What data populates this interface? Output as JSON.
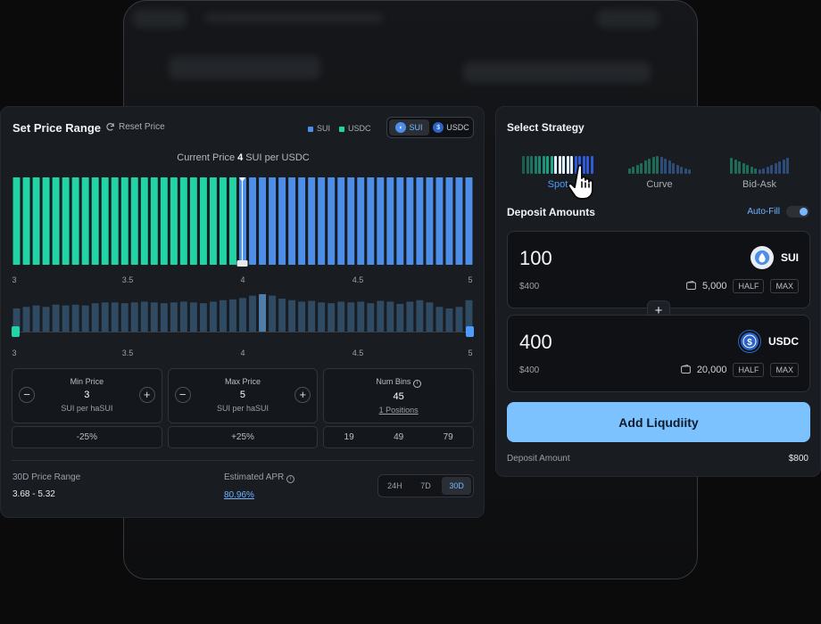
{
  "range_panel": {
    "title": "Set Price Range",
    "reset_label": "Reset Price",
    "legend": [
      {
        "label": "SUI",
        "color": "#4d8fe8"
      },
      {
        "label": "USDC",
        "color": "#22d3a6"
      }
    ],
    "token_toggle": [
      {
        "label": "SUI",
        "icon": "sui-icon",
        "active": true
      },
      {
        "label": "USDC",
        "icon": "usdc-icon",
        "active": false
      }
    ],
    "current_price": {
      "prefix": "Current Price",
      "value": "4",
      "suffix": "SUI per USDC"
    },
    "axis_ticks": [
      "3",
      "3.5",
      "4",
      "4.5",
      "5"
    ],
    "min_price": {
      "label": "Min Price",
      "value": "3",
      "unit": "SUI per haSUI",
      "pct": "-25%"
    },
    "max_price": {
      "label": "Max Price",
      "value": "5",
      "unit": "SUI per haSUI",
      "pct": "+25%"
    },
    "num_bins": {
      "label": "Num Bins",
      "value": "45",
      "sub": "1 Positions",
      "options": [
        "19",
        "49",
        "79"
      ]
    },
    "price_range_30d": {
      "label": "30D Price Range",
      "value": "3.68 - 5.32"
    },
    "apr": {
      "label": "Estimated APR",
      "value": "80.96%"
    },
    "periods": [
      {
        "label": "24H",
        "active": false
      },
      {
        "label": "7D",
        "active": false
      },
      {
        "label": "30D",
        "active": true
      }
    ]
  },
  "chart_data": [
    {
      "type": "bar",
      "x_range": [
        3,
        5
      ],
      "ticks": [
        3,
        3.5,
        4,
        4.5,
        5
      ],
      "series": [
        {
          "name": "USDC",
          "color": "#22d3a6",
          "values": [
            1,
            1,
            1,
            1,
            1,
            1,
            1,
            1,
            1,
            1,
            1,
            1,
            1,
            1,
            1,
            1,
            1,
            1,
            1,
            1,
            1,
            1,
            1,
            0,
            0,
            0,
            0,
            0,
            0,
            0,
            0,
            0,
            0,
            0,
            0,
            0,
            0,
            0,
            0,
            0,
            0,
            0,
            0,
            0,
            0,
            0,
            0
          ]
        },
        {
          "name": "SUI",
          "color": "#4d8fe8",
          "values": [
            0,
            0,
            0,
            0,
            0,
            0,
            0,
            0,
            0,
            0,
            0,
            0,
            0,
            0,
            0,
            0,
            0,
            0,
            0,
            0,
            0,
            0,
            0,
            1,
            1,
            1,
            1,
            1,
            1,
            1,
            1,
            1,
            1,
            1,
            1,
            1,
            1,
            1,
            1,
            1,
            1,
            1,
            1,
            1,
            1,
            1,
            1
          ]
        }
      ]
    },
    {
      "type": "bar",
      "x_range": [
        3,
        5
      ],
      "ticks": [
        3,
        3.5,
        4,
        4.5,
        5
      ],
      "values": [
        0.62,
        0.66,
        0.7,
        0.66,
        0.72,
        0.7,
        0.72,
        0.7,
        0.76,
        0.78,
        0.78,
        0.76,
        0.78,
        0.8,
        0.78,
        0.76,
        0.78,
        0.8,
        0.78,
        0.76,
        0.8,
        0.84,
        0.86,
        0.9,
        0.96,
        1.0,
        0.96,
        0.88,
        0.84,
        0.8,
        0.82,
        0.78,
        0.76,
        0.8,
        0.78,
        0.8,
        0.76,
        0.82,
        0.8,
        0.74,
        0.8,
        0.84,
        0.78,
        0.66,
        0.62,
        0.66,
        0.84
      ]
    }
  ],
  "strategy_panel": {
    "title": "Select Strategy",
    "strategies": [
      {
        "label": "Spot",
        "active": true
      },
      {
        "label": "Curve",
        "active": false
      },
      {
        "label": "Bid-Ask",
        "active": false
      }
    ],
    "deposit_title": "Deposit Amounts",
    "autofill_label": "Auto-Fill",
    "deposits": [
      {
        "amount": "100",
        "usd": "$400",
        "token": "SUI",
        "icon": "sui-icon",
        "balance": "5,000",
        "half": "HALF",
        "max": "MAX",
        "color": "#4d8fe8"
      },
      {
        "amount": "400",
        "usd": "$400",
        "token": "USDC",
        "icon": "usdc-icon",
        "balance": "20,000",
        "half": "HALF",
        "max": "MAX",
        "color": "#2a64c7"
      }
    ],
    "add_button": "Add Liqudiity",
    "deposit_amount_label": "Deposit Amount",
    "deposit_amount_value": "$800"
  }
}
